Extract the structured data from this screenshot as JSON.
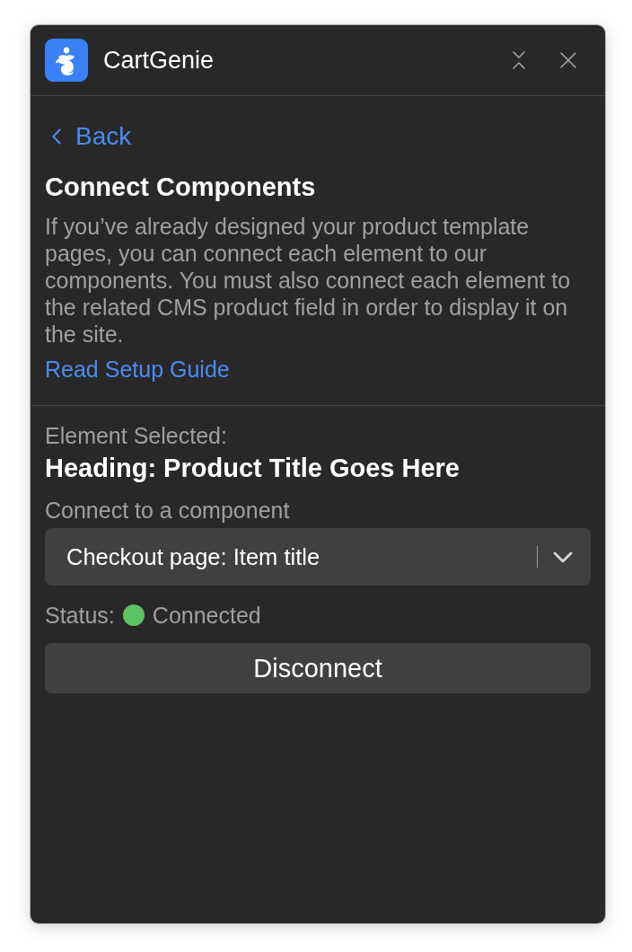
{
  "window": {
    "title": "CartGenie",
    "controls": [
      {
        "kind": "collapse"
      },
      {
        "kind": "close"
      }
    ]
  },
  "nav": {
    "back_label": "Back"
  },
  "intro": {
    "heading": "Connect Components",
    "body": "If you’ve already designed your product template pages, you can connect each element to our components. You must also connect each element to the related CMS product field in order to display it on the site.",
    "link": "Read Setup Guide"
  },
  "selection": {
    "label": "Element Selected:",
    "element": "Heading: Product Title Goes Here",
    "component_label": "Connect to a component",
    "component_value": "Checkout page: Item title",
    "status_label": "Status:",
    "status": {
      "text": "Connected",
      "color": "#5cc462"
    }
  },
  "buttons": [
    {
      "label": "Disconnect"
    }
  ]
}
